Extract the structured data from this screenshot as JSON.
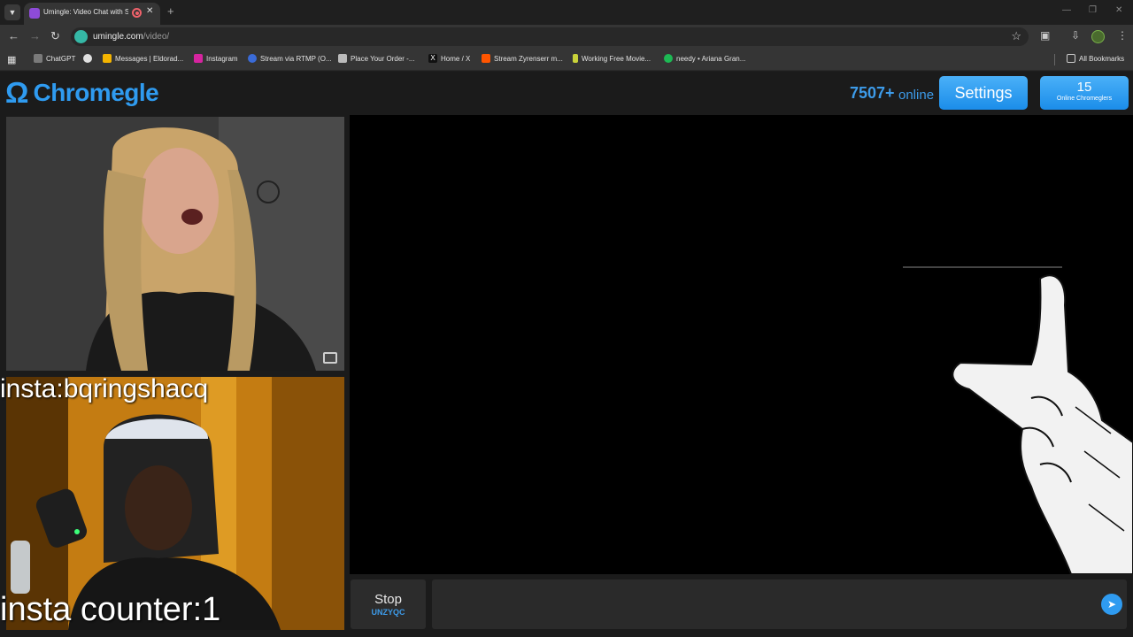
{
  "browser": {
    "tab": {
      "title": "Umingle: Video Chat with S"
    },
    "address_bar": {
      "url_host": "umingle.com",
      "url_path": "/video/"
    },
    "bookmarks": [
      {
        "label": "ChatGPT",
        "color": "#7a7a7a"
      },
      {
        "label": "",
        "color": "#e0e0e0"
      },
      {
        "label": "Messages | Eldorad...",
        "color": "#f4b400"
      },
      {
        "label": "Instagram",
        "color": "#d6249f"
      },
      {
        "label": "Stream via RTMP (O...",
        "color": "#3a6bd8"
      },
      {
        "label": "Place Your Order -...",
        "color": "#bbbbbb"
      },
      {
        "label": "Home / X",
        "color": "#111111"
      },
      {
        "label": "Stream Zyrenserr m...",
        "color": "#ff5500"
      },
      {
        "label": "Working Free Movie...",
        "color": "#c9d23a"
      },
      {
        "label": "needy • Ariana Gran...",
        "color": "#1db954"
      }
    ],
    "all_bookmarks": "All Bookmarks"
  },
  "header": {
    "logo_text": "Chromegle",
    "online_count": "7507+",
    "online_label": "online",
    "settings_label": "Settings",
    "online_chromeglers_count": "15",
    "online_chromeglers_label": "Online Chromeglers"
  },
  "videos": {
    "overlay_top": "insta:bqringshacq",
    "overlay_bottom": "insta counter:1"
  },
  "chat": {
    "stop_label": "Stop",
    "stop_code": "UNZYQC",
    "input_value": ""
  },
  "colors": {
    "accent": "#2f9bf0",
    "background": "#1b1b1b"
  }
}
